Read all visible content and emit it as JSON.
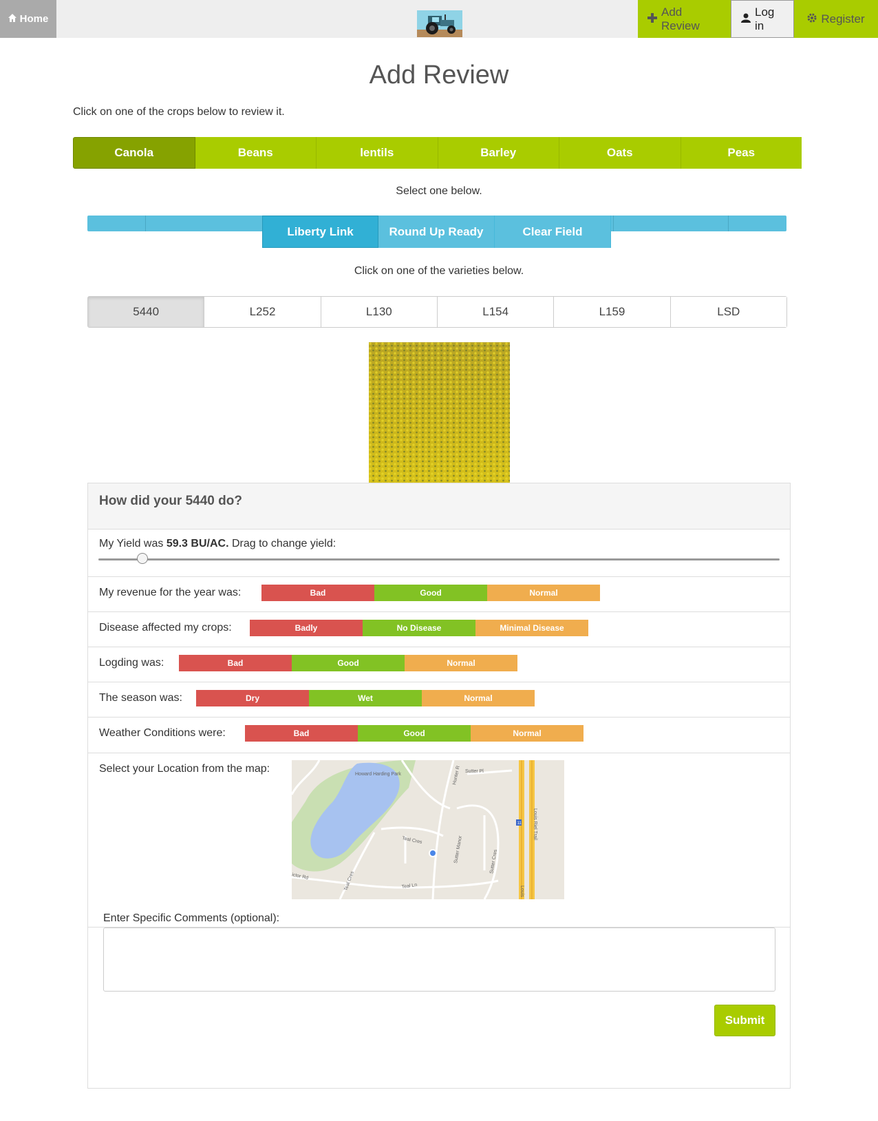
{
  "nav": {
    "home_label": "Home",
    "add_review_label": "Add Review",
    "login_label": "Log in",
    "register_label": "Register",
    "accent": "#a9cc00"
  },
  "page": {
    "title": "Add Review",
    "crop_hint": "Click on one of the crops below to review it.",
    "herb_hint": "Select one below.",
    "variety_hint": "Click on one of the varieties below."
  },
  "crops": [
    {
      "label": "Canola",
      "active": true
    },
    {
      "label": "Beans",
      "active": false
    },
    {
      "label": "lentils",
      "active": false
    },
    {
      "label": "Barley",
      "active": false
    },
    {
      "label": "Oats",
      "active": false
    },
    {
      "label": "Peas",
      "active": false
    }
  ],
  "herbicides": [
    {
      "label": "Liberty Link",
      "active": true
    },
    {
      "label": "Round Up Ready",
      "active": false
    },
    {
      "label": "Clear Field",
      "active": false
    }
  ],
  "varieties": [
    {
      "label": "5440",
      "active": true
    },
    {
      "label": "L252",
      "active": false
    },
    {
      "label": "L130",
      "active": false
    },
    {
      "label": "L154",
      "active": false
    },
    {
      "label": "L159",
      "active": false
    },
    {
      "label": "LSD",
      "active": false
    }
  ],
  "review": {
    "heading": "How did your 5440 do?",
    "yield_prefix": "My Yield was ",
    "yield_value": "59.3 BU/AC.",
    "yield_suffix": " Drag to change yield:",
    "yield_slider_fraction": 0.065,
    "questions": [
      {
        "label": "My revenue for the year was:",
        "options": [
          "Bad",
          "Good",
          "Normal"
        ]
      },
      {
        "label": "Disease affected my crops:",
        "options": [
          "Badly",
          "No Disease",
          "Minimal Disease"
        ]
      },
      {
        "label": "Logding was:",
        "options": [
          "Bad",
          "Good",
          "Normal"
        ]
      },
      {
        "label": "The season was:",
        "options": [
          "Dry",
          "Wet",
          "Normal"
        ]
      },
      {
        "label": "Weather Conditions were:",
        "options": [
          "Bad",
          "Good",
          "Normal"
        ]
      }
    ],
    "location_label": "Select your Location from the map:",
    "map": {
      "labels": [
        "Howard Harding Park",
        "Sutter Pl",
        "Hunter R",
        "Teal Cres",
        "Sutter Manor",
        "Sutter Cres",
        "Louis Riel Trail",
        "Teal Cres",
        "Teal Ln",
        "ictor Rd",
        "Louis",
        "11"
      ]
    },
    "comments_label": "Enter Specific Comments (optional):",
    "submit_label": "Submit"
  },
  "colors": {
    "choice_red": "#d9534f",
    "choice_green": "#82c224",
    "choice_orange": "#f0ad4e",
    "herb_blue": "#5bc0de"
  }
}
